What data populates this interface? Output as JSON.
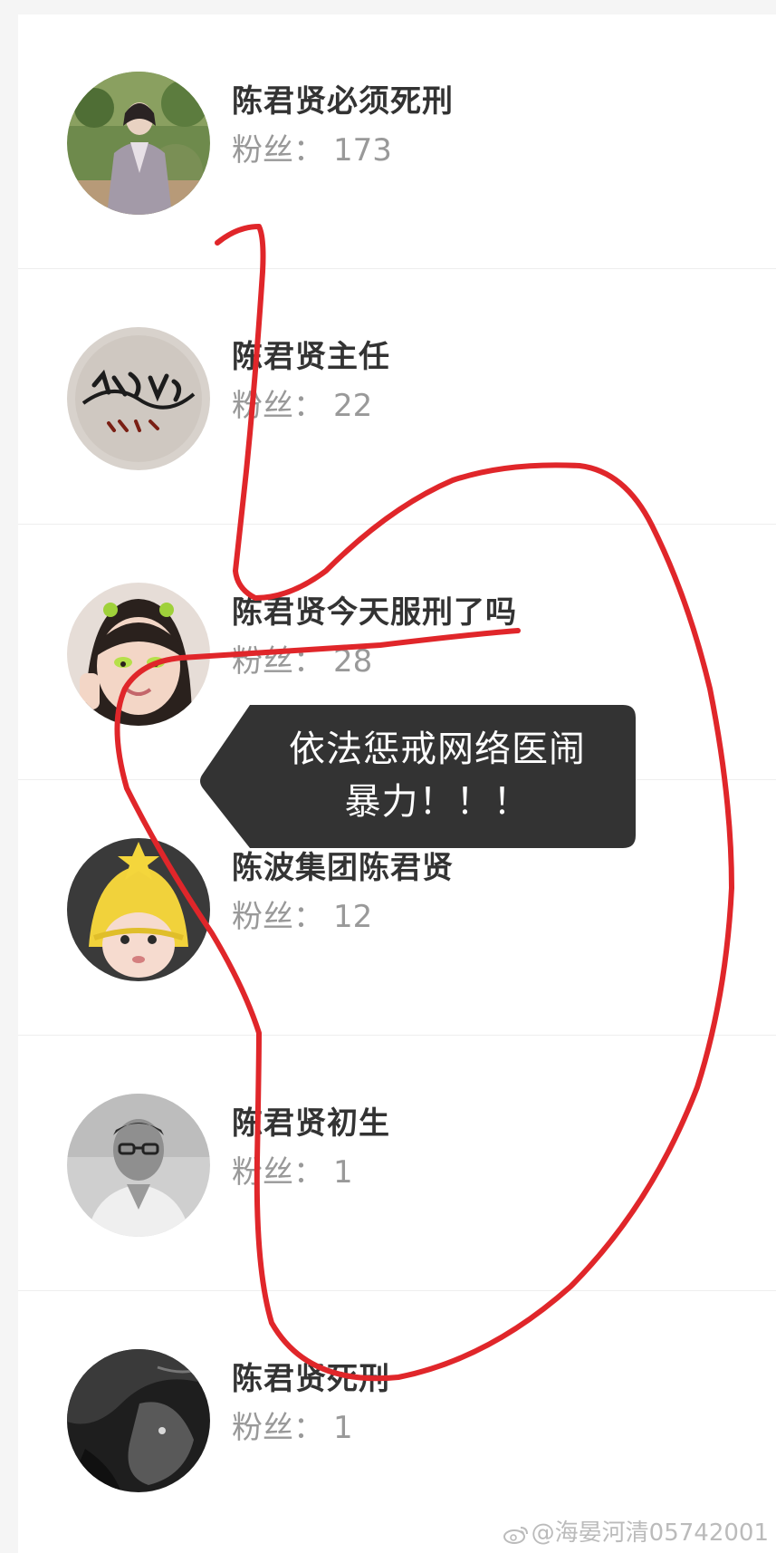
{
  "users": [
    {
      "name": "陈君贤必须死刑",
      "fans_label": "粉丝：",
      "fans_count": "173",
      "avatar": "woman-in-garden-avatar"
    },
    {
      "name": "陈君贤主任",
      "fans_label": "粉丝：",
      "fans_count": "22",
      "avatar": "calligraphy-logo-avatar"
    },
    {
      "name": "陈君贤今天服刑了吗",
      "fans_label": "粉丝：",
      "fans_count": "28",
      "avatar": "little-girl-avatar"
    },
    {
      "name": "陈波集团陈君贤",
      "fans_label": "粉丝：",
      "fans_count": "12",
      "avatar": "baby-in-hat-avatar"
    },
    {
      "name": "陈君贤初生",
      "fans_label": "粉丝：",
      "fans_count": "1",
      "avatar": "man-portrait-avatar"
    },
    {
      "name": "陈君贤死刑",
      "fans_label": "粉丝：",
      "fans_count": "1",
      "avatar": "dark-photo-avatar"
    }
  ],
  "tooltip": {
    "line1": "依法惩戒网络医闹",
    "line2": "暴力！！！"
  },
  "watermark": "@海晏河清05742001",
  "colors": {
    "annotation_red": "#e0262a",
    "tooltip_bg": "#333333",
    "name_text": "#333333",
    "fans_text": "#999999"
  }
}
